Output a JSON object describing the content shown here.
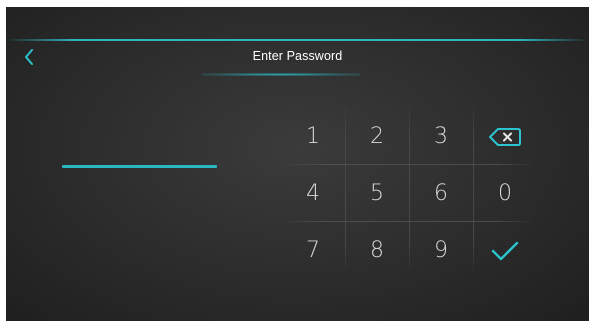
{
  "header": {
    "title": "Enter Password",
    "back_icon": "chevron-left-icon",
    "accent_color": "#2bb6c0"
  },
  "password": {
    "value": "",
    "placeholder": ""
  },
  "keypad": {
    "keys": [
      {
        "label": "1",
        "type": "digit"
      },
      {
        "label": "2",
        "type": "digit"
      },
      {
        "label": "3",
        "type": "digit"
      },
      {
        "label": "",
        "type": "backspace",
        "icon": "backspace-icon"
      },
      {
        "label": "4",
        "type": "digit"
      },
      {
        "label": "5",
        "type": "digit"
      },
      {
        "label": "6",
        "type": "digit"
      },
      {
        "label": "0",
        "type": "digit"
      },
      {
        "label": "7",
        "type": "digit"
      },
      {
        "label": "8",
        "type": "digit"
      },
      {
        "label": "9",
        "type": "digit"
      },
      {
        "label": "",
        "type": "confirm",
        "icon": "checkmark-icon"
      }
    ]
  }
}
